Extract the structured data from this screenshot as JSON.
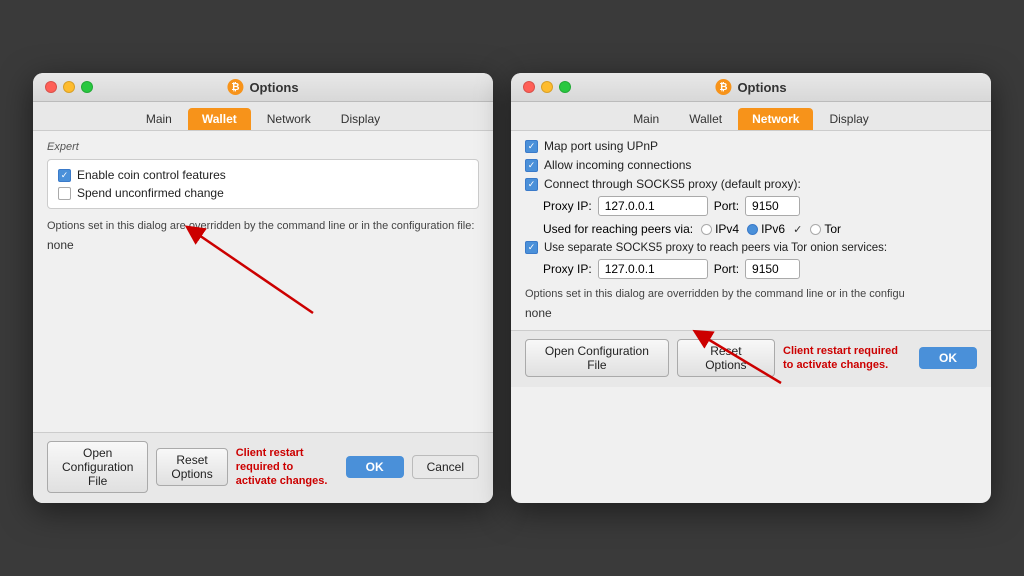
{
  "left_dialog": {
    "title": "Options",
    "tabs": [
      "Main",
      "Wallet",
      "Network",
      "Display"
    ],
    "active_tab": "Wallet",
    "section_label": "Expert",
    "checkbox1_label": "Enable coin control features",
    "checkbox1_checked": true,
    "checkbox2_label": "Spend unconfirmed change",
    "checkbox2_checked": false,
    "note": "Options set in this dialog are overridden by the command line or in the configuration file:",
    "none_text": "none",
    "btn_open_config": "Open Configuration File",
    "btn_reset": "Reset Options",
    "btn_ok": "OK",
    "btn_cancel": "Cancel",
    "restart_notice": "Client restart required to activate changes."
  },
  "right_dialog": {
    "title": "Options",
    "tabs": [
      "Main",
      "Wallet",
      "Network",
      "Display"
    ],
    "active_tab": "Network",
    "checkbox_map_port_label": "Map port using UPnP",
    "checkbox_map_port_checked": true,
    "checkbox_incoming_label": "Allow incoming connections",
    "checkbox_incoming_checked": true,
    "checkbox_socks5_label": "Connect through SOCKS5 proxy (default proxy):",
    "checkbox_socks5_checked": true,
    "proxy_ip_label": "Proxy IP:",
    "proxy_ip_value": "127.0.0.1",
    "port_label": "Port:",
    "port_value": "9150",
    "peers_label": "Used for reaching peers via:",
    "ipv4_label": "IPv4",
    "ipv6_label": "IPv6",
    "tor_label": "Tor",
    "ipv6_checked": true,
    "checkbox_sep_socks5_label": "Use separate SOCKS5 proxy to reach peers via Tor onion services:",
    "checkbox_sep_socks5_checked": true,
    "proxy2_ip_value": "127.0.0.1",
    "port2_value": "9150",
    "note": "Options set in this dialog are overridden by the command line or in the configu",
    "none_text": "none",
    "btn_open_config": "Open Configuration File",
    "btn_reset": "Reset Options",
    "btn_ok": "OK",
    "restart_notice": "Client restart required to activate changes."
  }
}
